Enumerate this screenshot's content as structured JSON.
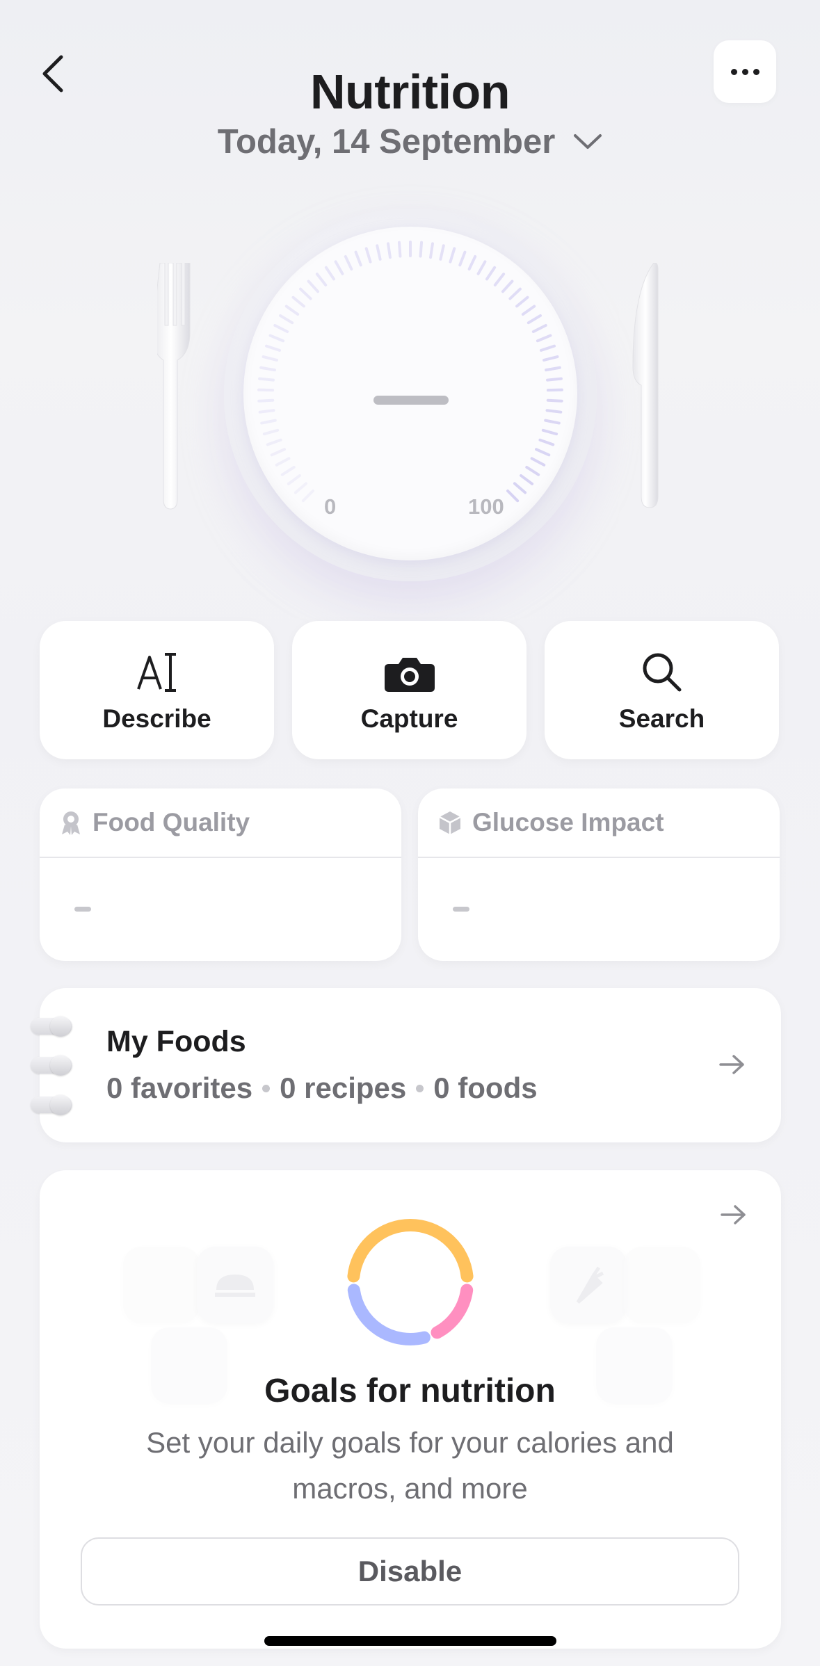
{
  "header": {
    "title": "Nutrition",
    "date": "Today, 14 September",
    "back_icon": "chevron-left-icon",
    "more_icon": "ellipsis-icon"
  },
  "plate": {
    "value": "–",
    "scale_min": "0",
    "scale_max": "100",
    "progress": 0
  },
  "actions": [
    {
      "label": "Describe",
      "icon": "text-cursor-icon"
    },
    {
      "label": "Capture",
      "icon": "camera-icon"
    },
    {
      "label": "Search",
      "icon": "search-icon"
    }
  ],
  "metrics": [
    {
      "label": "Food Quality",
      "value": "–",
      "icon": "award-icon"
    },
    {
      "label": "Glucose Impact",
      "value": "–",
      "icon": "cube-icon"
    }
  ],
  "my_foods": {
    "title": "My Foods",
    "favorites": "0 favorites",
    "recipes": "0 recipes",
    "foods": "0 foods"
  },
  "goals": {
    "title": "Goals for nutrition",
    "subtitle": "Set your daily goals for your calories and macros, and more",
    "button": "Disable"
  },
  "colors": {
    "ring_orange": "#ffc25c",
    "ring_blue": "#aab8ff",
    "ring_pink": "#ff8fc0",
    "tick": "#d7d3f3"
  }
}
